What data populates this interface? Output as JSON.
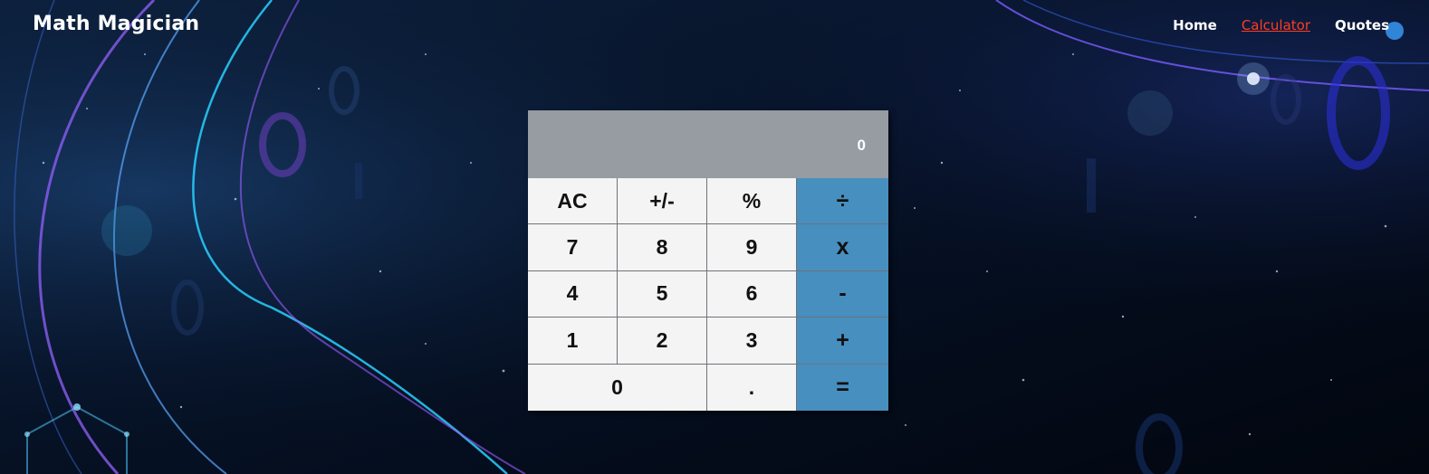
{
  "brand": "Math Magician",
  "nav": {
    "home": "Home",
    "calculator": "Calculator",
    "quotes": "Quotes"
  },
  "calculator": {
    "display": "0",
    "keys": {
      "ac": "AC",
      "sign": "+/-",
      "percent": "%",
      "divide": "÷",
      "seven": "7",
      "eight": "8",
      "nine": "9",
      "multiply": "x",
      "four": "4",
      "five": "5",
      "six": "6",
      "minus": "-",
      "one": "1",
      "two": "2",
      "three": "3",
      "plus": "+",
      "zero": "0",
      "dot": ".",
      "equals": "="
    }
  },
  "colors": {
    "background": "#050d1e",
    "display": "#979ba2",
    "key": "#f4f4f4",
    "operator_key": "#478fbf",
    "active_link": "#ff3d1f",
    "text_light": "#ffffff"
  }
}
